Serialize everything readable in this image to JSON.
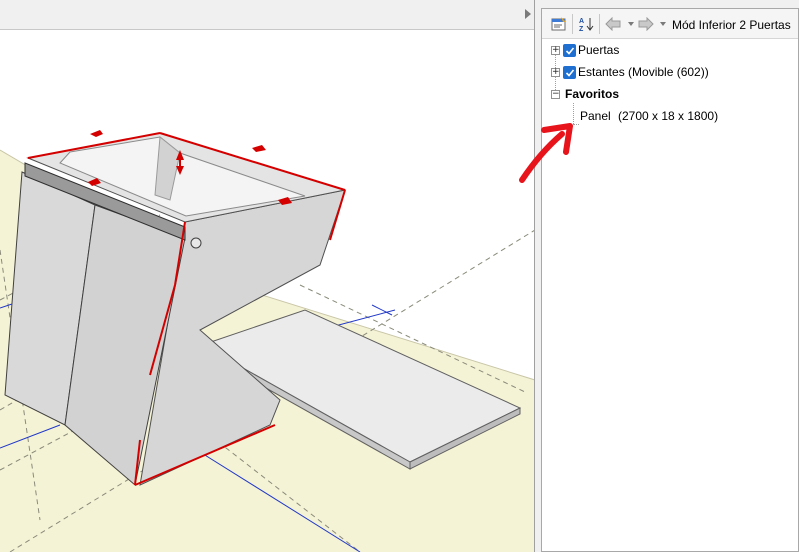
{
  "toolbar": {
    "title": "Mód Inferior 2 Puertas",
    "icons": [
      "properties-icon",
      "sort-az-icon",
      "back-arrow-icon",
      "forward-arrow-icon"
    ]
  },
  "tree": {
    "items": [
      {
        "label": "Puertas",
        "checked": true,
        "expander": "+"
      },
      {
        "label": "Estantes (Movible (602))",
        "checked": true,
        "expander": "+"
      },
      {
        "label": "Favoritos",
        "bold": true,
        "expander": "−"
      }
    ],
    "panel_item": {
      "name": "Panel",
      "size": "(2700 x 18 x 1800)"
    }
  },
  "colors": {
    "checkbox": "#1f6fd1",
    "annotation_arrow": "#e8141c",
    "cabinet_edge": "#d40000",
    "floor": "#f5f3d6",
    "guide_lines": "#2038c8"
  }
}
